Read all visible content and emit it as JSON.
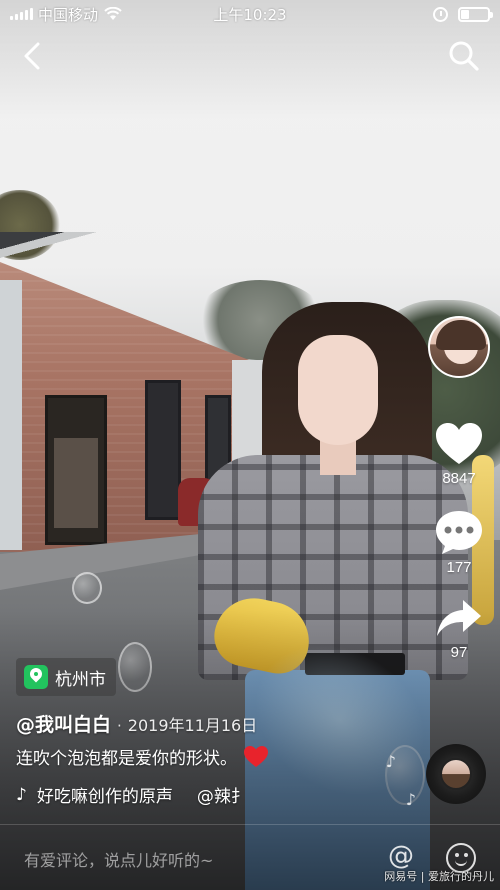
{
  "status_bar": {
    "carrier": "中国移动",
    "time": "上午10:23",
    "battery_level": 0.3
  },
  "video": {
    "location": "杭州市",
    "author": "@我叫白白",
    "separator": "·",
    "date": "2019年11月16日",
    "caption": "连吹个泡泡都是爱你的形状。",
    "music_credit": "好吃嘛创作的原声",
    "music_mention": "@辣扌"
  },
  "actions": {
    "like_count": "8847",
    "comment_count": "177",
    "share_count": "97"
  },
  "comment_bar": {
    "placeholder": "有爱评论，说点儿好听的~",
    "at_symbol": "@"
  },
  "watermark": "网易号 | 爱旅行的丹儿",
  "icons": {
    "back": "chevron-left-icon",
    "search": "search-icon",
    "like": "heart-icon",
    "comment": "comment-icon",
    "share": "share-arrow-icon",
    "location": "location-pin-icon",
    "music": "music-note-icon",
    "emoji": "smiley-icon"
  },
  "colors": {
    "location_badge": "#22c35e",
    "heart_emoji": "#e8232c"
  }
}
